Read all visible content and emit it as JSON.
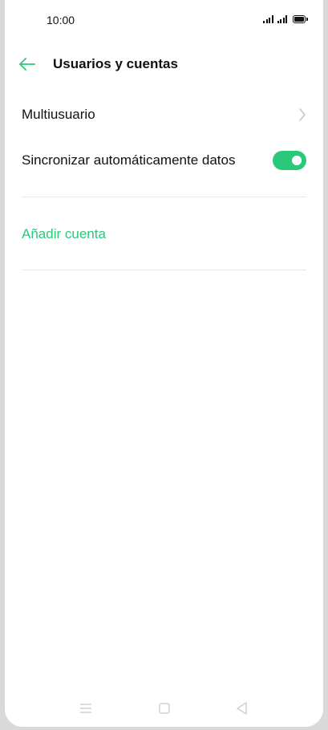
{
  "status_bar": {
    "time": "10:00",
    "icons": [
      "signal-icon",
      "signal-icon",
      "battery-icon"
    ]
  },
  "header": {
    "back_icon": "arrow-left-icon",
    "title": "Usuarios y cuentas"
  },
  "settings": {
    "multiuser": {
      "label": "Multiusuario",
      "icon": "chevron-right-icon"
    },
    "auto_sync": {
      "label": "Sincronizar automáticamente datos",
      "enabled": true
    },
    "add_account": {
      "label": "Añadir cuenta"
    }
  },
  "nav_bar": {
    "icons": [
      "menu-icon",
      "home-icon",
      "back-triangle-icon"
    ]
  },
  "colors": {
    "accent": "#2bc77a",
    "text": "#111111",
    "divider": "#e8e8e8",
    "background": "#ffffff"
  }
}
